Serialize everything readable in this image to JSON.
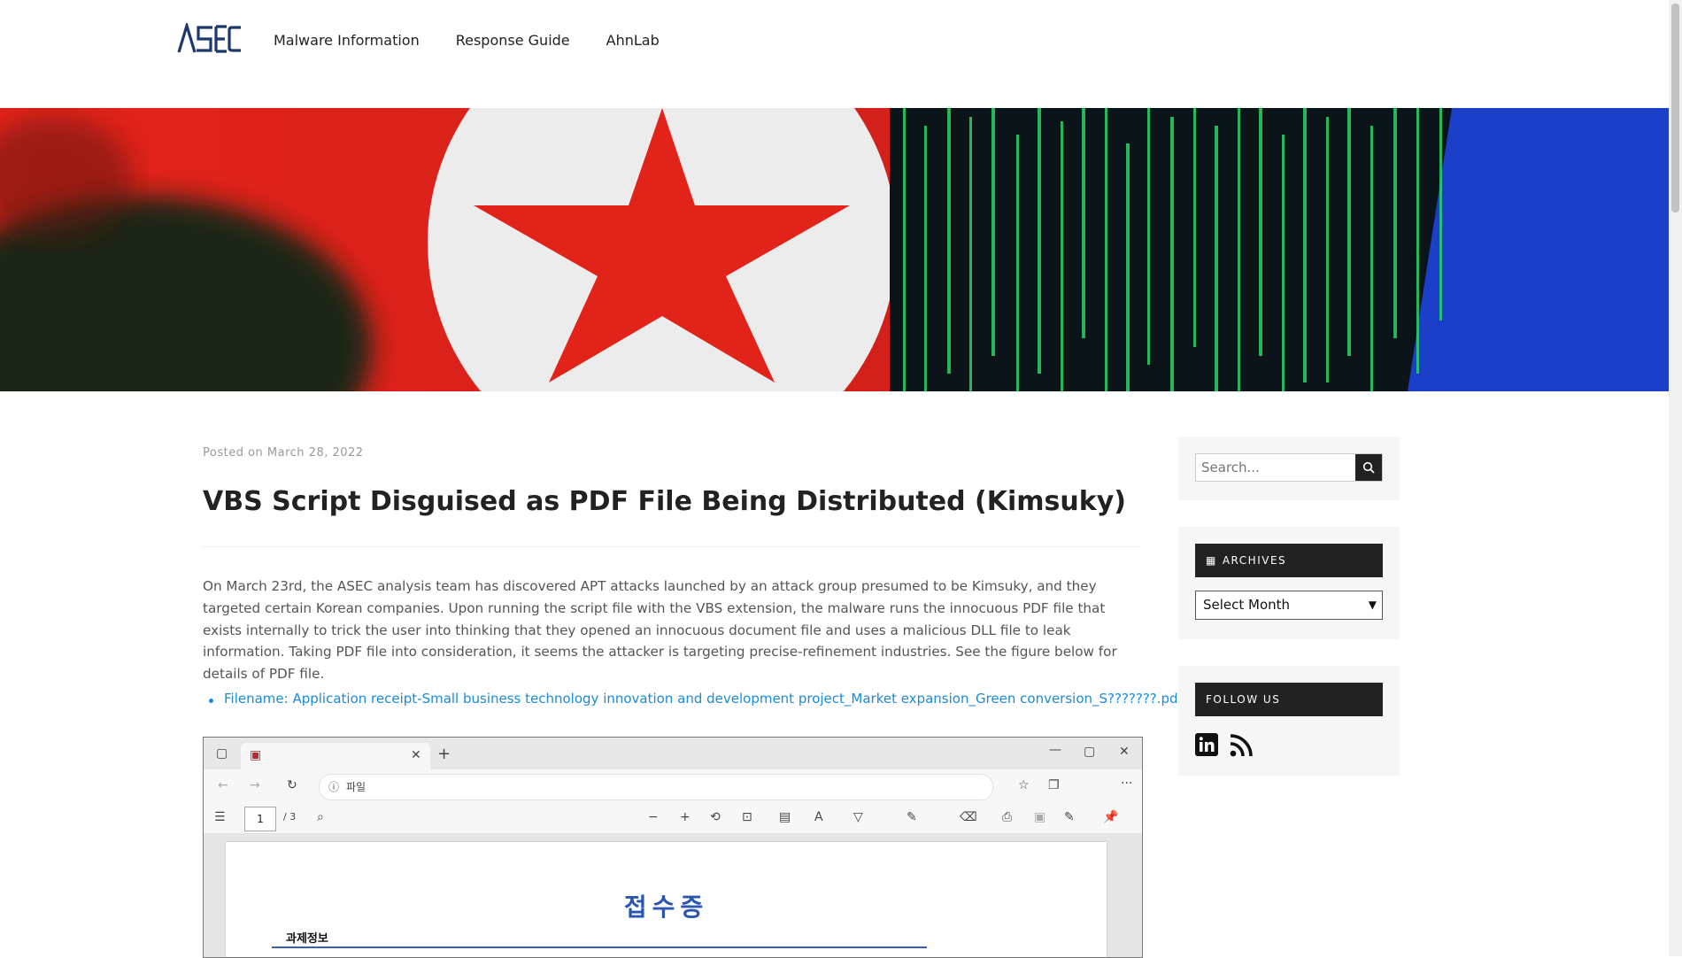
{
  "header": {
    "logo_text": "ASEC",
    "nav": [
      "Malware Information",
      "Response Guide",
      "AhnLab"
    ]
  },
  "post": {
    "posted_prefix": "Posted on",
    "posted_date": "March 28, 2022",
    "title": "VBS Script Disguised as PDF File Being Distributed (Kimsuky)",
    "paragraph": "On March 23rd, the ASEC analysis team has discovered APT attacks launched by an attack group presumed to be Kimsuky, and they targeted certain Korean companies. Upon running the script file with the VBS extension, the malware runs the innocuous PDF file that exists internally to trick the user into thinking that they opened an innocuous document file and uses a malicious DLL file to leak information. Taking PDF file into consideration, it seems the attacker is targeting precise-refinement industries. See the figure below for details of PDF file.",
    "bullet": "Filename: Application receipt-Small business technology innovation and development project_Market expansion_Green conversion_S???????.pdf.vbs"
  },
  "figure": {
    "address_prefix": "파일",
    "page_number": "1",
    "page_total": "/ 3",
    "pdf_heading": "접수증",
    "pdf_subheading": "과제정보"
  },
  "sidebar": {
    "search_placeholder": "Search...",
    "archives_title": "ARCHIVES",
    "archives_select": "Select Month",
    "follow_title": "FOLLOW US"
  },
  "colors": {
    "link": "#1a8bd8",
    "widget_title_bg": "#222222",
    "logo": "#1b3a6b"
  }
}
